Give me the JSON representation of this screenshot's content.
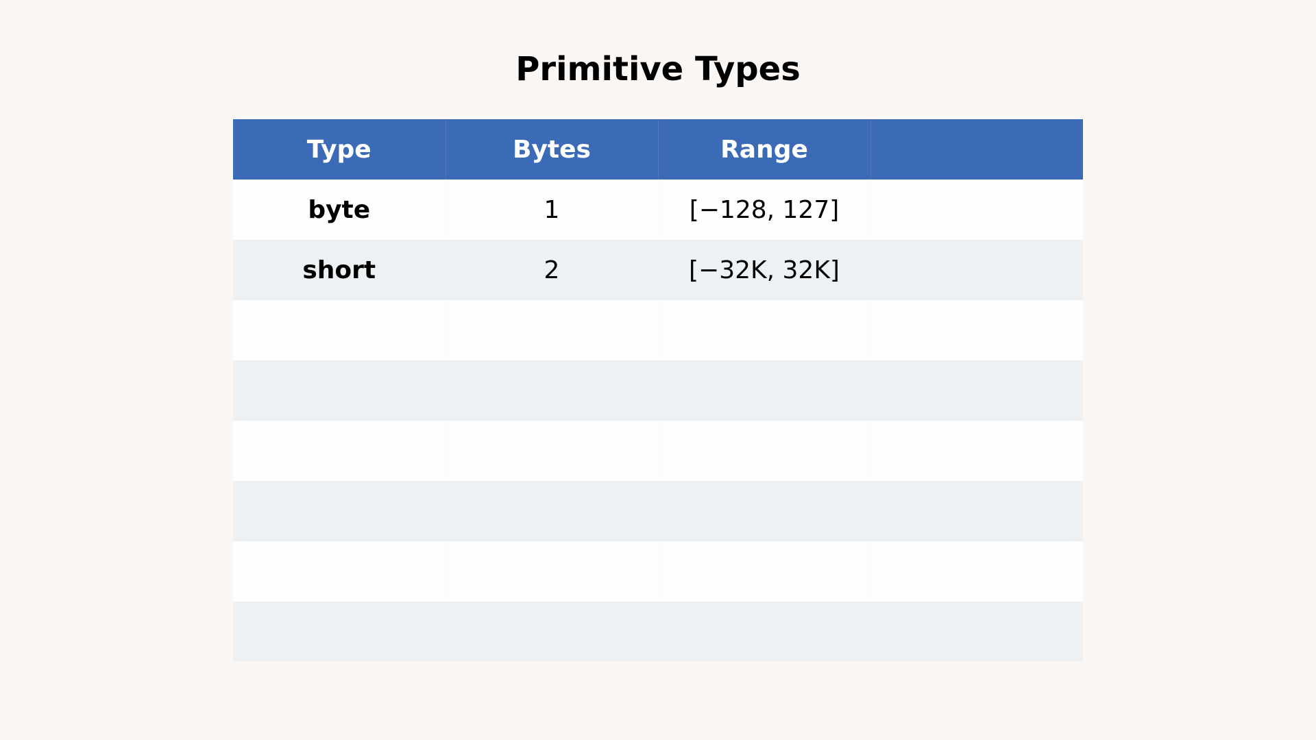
{
  "title": "Primitive Types",
  "table": {
    "headers": [
      "Type",
      "Bytes",
      "Range",
      ""
    ],
    "rows": [
      [
        "byte",
        "1",
        "[−128, 127]",
        ""
      ],
      [
        "short",
        "2",
        "[−32K, 32K]",
        ""
      ],
      [
        "",
        "",
        "",
        ""
      ],
      [
        "",
        "",
        "",
        ""
      ],
      [
        "",
        "",
        "",
        ""
      ],
      [
        "",
        "",
        "",
        ""
      ],
      [
        "",
        "",
        "",
        ""
      ],
      [
        "",
        "",
        "",
        ""
      ]
    ]
  },
  "colors": {
    "background": "#fbf7f4",
    "header": "#3b6ab7",
    "row_light": "#fdfdfd",
    "row_alt": "#edf1f4"
  }
}
